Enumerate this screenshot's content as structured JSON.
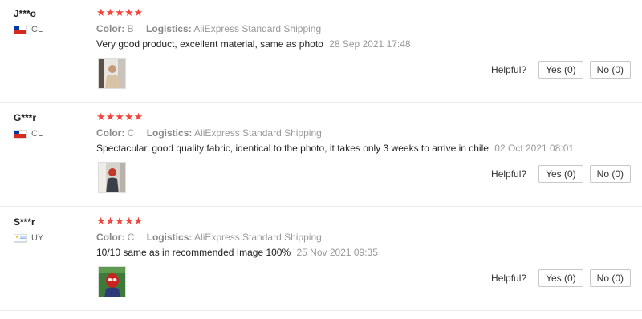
{
  "reviews": [
    {
      "user": "J***o",
      "country": "CL",
      "stars": "★★★★★",
      "color_label": "Color:",
      "color_value": "B",
      "logistics_label": "Logistics:",
      "logistics_value": "AliExpress Standard Shipping",
      "text": "Very good product, excellent material, same as photo",
      "date": "28 Sep 2021 17:48",
      "helpful_label": "Helpful?",
      "yes_label": "Yes (0)",
      "no_label": "No (0)"
    },
    {
      "user": "G***r",
      "country": "CL",
      "stars": "★★★★★",
      "color_label": "Color:",
      "color_value": "C",
      "logistics_label": "Logistics:",
      "logistics_value": "AliExpress Standard Shipping",
      "text": "Spectacular, good quality fabric, identical to the photo, it takes only 3 weeks to arrive in chile",
      "date": "02 Oct 2021 08:01",
      "helpful_label": "Helpful?",
      "yes_label": "Yes (0)",
      "no_label": "No (0)"
    },
    {
      "user": "S***r",
      "country": "UY",
      "stars": "★★★★★",
      "color_label": "Color:",
      "color_value": "C",
      "logistics_label": "Logistics:",
      "logistics_value": "AliExpress Standard Shipping",
      "text": "10/10 same as in recommended Image 100%",
      "date": "25 Nov 2021 09:35",
      "helpful_label": "Helpful?",
      "yes_label": "Yes (0)",
      "no_label": "No (0)"
    }
  ],
  "colors": {
    "star": "#f0453a",
    "meta_text": "#999999",
    "divider": "#ececec"
  }
}
